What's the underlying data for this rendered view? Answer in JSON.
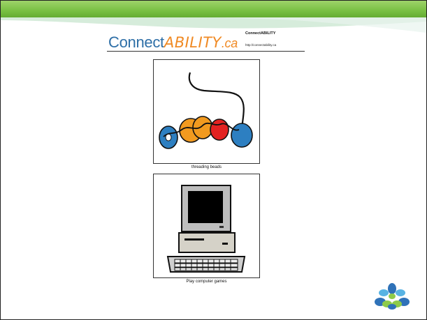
{
  "header": {
    "logo": {
      "prefix": "Connect",
      "highlight": "ABILITY",
      "suffix": ".ca"
    },
    "brand_name": "ConnectABILITY",
    "url": "http://connectability.ca"
  },
  "cards": [
    {
      "caption": "threading beads",
      "icon": "threading-beads-icon"
    },
    {
      "caption": "Play computer games",
      "icon": "computer-icon"
    }
  ],
  "corner_logo": "flower-logo-icon",
  "colors": {
    "top_bar": "#79c043",
    "logo_blue": "#2e6fa7",
    "logo_orange": "#f08a24"
  }
}
